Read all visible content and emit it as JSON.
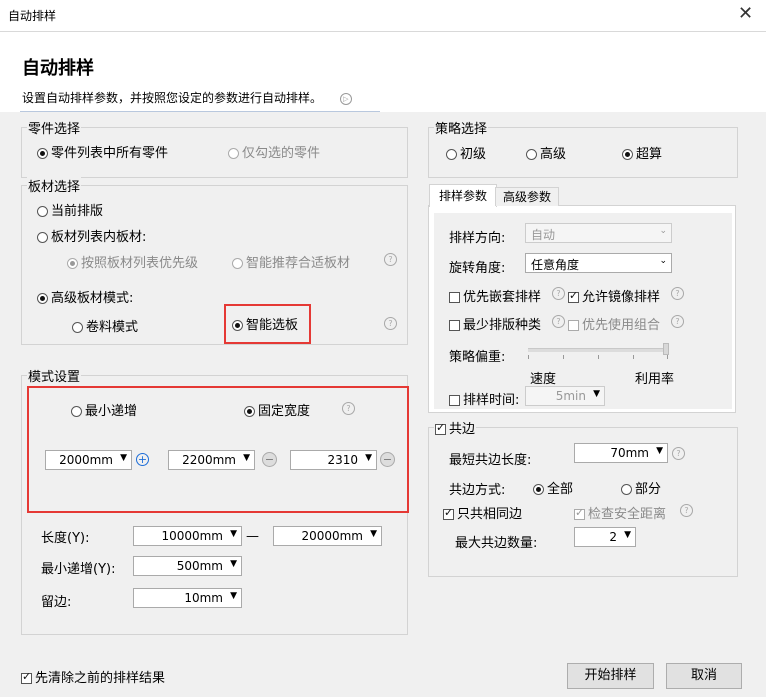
{
  "window": {
    "title": "自动排样",
    "close": "✕"
  },
  "header": {
    "title": "自动排样",
    "subtitle": "设置自动排样参数，并按照您设定的参数进行自动排样。",
    "info_icon": "▷"
  },
  "parts": {
    "title": "零件选择",
    "all": "零件列表中所有零件",
    "checked": "仅勾选的零件"
  },
  "sheet": {
    "title": "板材选择",
    "current": "当前排版",
    "list": "板材列表内板材:",
    "priority": "按照板材列表优先级",
    "recommend": "智能推荐合适板材",
    "advanced": "高级板材模式:",
    "roll": "卷料模式",
    "smart": "智能选板"
  },
  "mode": {
    "title": "模式设置",
    "min_inc": "最小递增",
    "fixed_width": "固定宽度",
    "w1": "2000mm",
    "w2": "2200mm",
    "w3": "2310",
    "length_label": "长度(Y):",
    "length_from": "10000mm",
    "length_sep": "—",
    "length_to": "20000mm",
    "min_inc_label": "最小递增(Y):",
    "min_inc_value": "500mm",
    "margin_label": "留边:",
    "margin_value": "10mm"
  },
  "strategy": {
    "title": "策略选择",
    "basic": "初级",
    "advanced": "高级",
    "super": "超算"
  },
  "tabs": {
    "nest": "排样参数",
    "advanced": "高级参数"
  },
  "nest": {
    "direction_label": "排样方向:",
    "direction_value": "自动",
    "rotation_label": "旋转角度:",
    "rotation_value": "任意角度",
    "prefer_embed": "优先嵌套排样",
    "allow_mirror": "允许镜像排样",
    "min_types": "最少排版种类",
    "prefer_combo": "优先使用组合",
    "bias_label": "策略偏重:",
    "speed": "速度",
    "utilization": "利用率",
    "time_label": "排样时间:",
    "time_value": "5min"
  },
  "common": {
    "title": "共边",
    "min_len_label": "最短共边长度:",
    "min_len_value": "70mm",
    "method_label": "共边方式:",
    "all": "全部",
    "part": "部分",
    "same_only": "只共相同边",
    "check_safe": "检查安全距离",
    "max_label": "最大共边数量:",
    "max_value": "2"
  },
  "footer": {
    "clear": "先清除之前的排样结果",
    "start": "开始排样",
    "cancel": "取消"
  },
  "icons": {
    "question": "?",
    "plus": "+",
    "minus": "−",
    "arrow": "▼"
  }
}
